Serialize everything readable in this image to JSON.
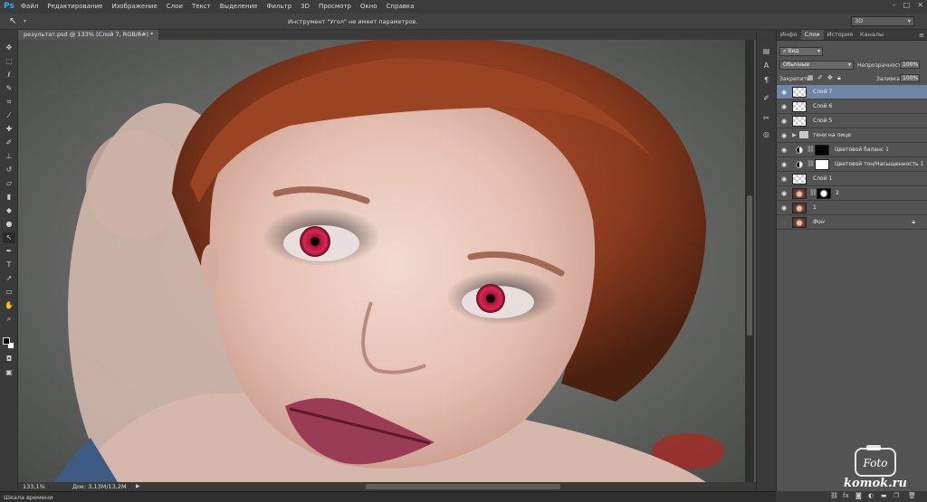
{
  "app": {
    "logo": "Ps",
    "menu": [
      "Файл",
      "Редактирование",
      "Изображение",
      "Слои",
      "Текст",
      "Выделение",
      "Фильтр",
      "3D",
      "Просмотр",
      "Окно",
      "Справка"
    ],
    "window_controls": [
      "–",
      "□",
      "✕"
    ]
  },
  "options_bar": {
    "message": "Инструмент \"Угол\" не имеет параметров.",
    "workspace": "3D"
  },
  "document": {
    "tab_title": "результат.psd @ 133% (Слой 7, RGB/8#) *",
    "zoom": "133,1%",
    "doc_size": "Док: 3,13M/13,2M"
  },
  "timeline": {
    "label": "Шкала времени"
  },
  "layers_panel": {
    "tabs": [
      "Инфо",
      "Слои",
      "История",
      "Каналы"
    ],
    "active_tab": "Слои",
    "filter_kind": "Вид",
    "blend_mode": "Обычные",
    "opacity_label": "Непрозрачность:",
    "opacity_value": "100%",
    "lock_label": "Закрепить:",
    "fill_label": "Заливка:",
    "fill_value": "100%",
    "layers": [
      {
        "name": "Слой 7",
        "type": "pixel",
        "visible": true,
        "selected": true
      },
      {
        "name": "Слой 6",
        "type": "pixel",
        "visible": true,
        "selected": false
      },
      {
        "name": "Слой 5",
        "type": "pixel",
        "visible": true,
        "selected": false
      },
      {
        "name": "тени на лице",
        "type": "group",
        "visible": true,
        "selected": false
      },
      {
        "name": "Цветовой баланс 1",
        "type": "adjustment",
        "visible": true,
        "selected": false
      },
      {
        "name": "Цветовой тон/Насыщенность 1",
        "type": "adjustment",
        "visible": true,
        "selected": false
      },
      {
        "name": "Слой 1",
        "type": "pixel",
        "visible": true,
        "selected": false
      },
      {
        "name": "2",
        "type": "masked-photo",
        "visible": true,
        "selected": false
      },
      {
        "name": "1",
        "type": "photo",
        "visible": true,
        "selected": false
      },
      {
        "name": "Фон",
        "type": "background",
        "visible": false,
        "selected": false,
        "locked": true
      }
    ]
  },
  "watermark": {
    "line1": "Foto",
    "line2": "komok.ru"
  },
  "colors": {
    "menubar": "#3c3c3c",
    "panel": "#535353",
    "selected_layer": "#6f85a8",
    "ps_blue": "#31a8ff"
  }
}
